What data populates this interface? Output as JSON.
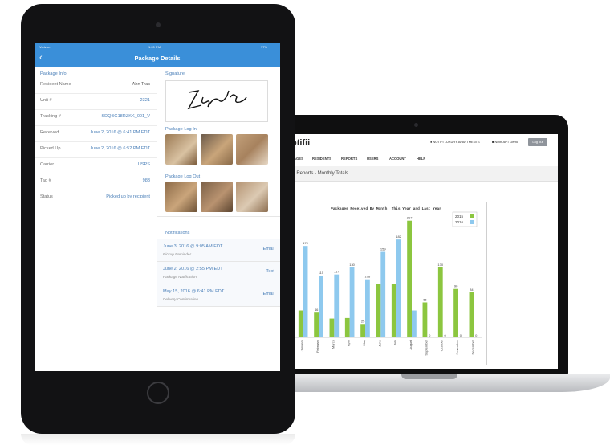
{
  "ipad": {
    "status": {
      "carrier": "Verizon",
      "time": "1:20 PM",
      "battery": "77%"
    },
    "title": "Package Details",
    "package_info_header": "Package Info",
    "info_rows": [
      {
        "key": "Resident Name",
        "value": "Ahn Tras"
      },
      {
        "key": "Unit #",
        "value": "2321"
      },
      {
        "key": "Tracking #",
        "value": "SDQBG18RZKK_001_V"
      },
      {
        "key": "Received",
        "value": "June 2, 2016 @ 6:41 PM EDT"
      },
      {
        "key": "Picked Up",
        "value": "June 2, 2016 @ 6:52 PM EDT"
      },
      {
        "key": "Carrier",
        "value": "USPS"
      },
      {
        "key": "Tag #",
        "value": "983"
      },
      {
        "key": "Status",
        "value": "Picked up by recipient"
      }
    ],
    "signature_label": "Signature",
    "log_in_label": "Package Log In",
    "log_out_label": "Package Log Out",
    "notifications_label": "Notifications",
    "notifications": [
      {
        "date": "June 3, 2016 @ 9:05 AM EDT",
        "type": "Pickup Reminder",
        "method": "Email"
      },
      {
        "date": "June 2, 2016 @ 2:55 PM EDT",
        "type": "Package Notification",
        "method": "Text"
      },
      {
        "date": "May 15, 2016 @ 6:41 PM EDT",
        "type": "Delivery Confirmation",
        "method": "Email"
      }
    ]
  },
  "laptop": {
    "brand": "otifii",
    "apartment": "NOTIFI LUXURY APARTMENTS",
    "user": "Notifi APT Demo",
    "logout": "Log out",
    "nav": [
      "KAGES",
      "RESIDENTS",
      "REPORTS",
      "USERS",
      "ACCOUNT",
      "HELP"
    ],
    "subtitle": "ge Reports - Monthly Totals"
  },
  "chart_data": {
    "type": "bar",
    "title": "Packages Received By Month, This Year and Last Year",
    "categories": [
      "January",
      "February",
      "March",
      "April",
      "May",
      "June",
      "July",
      "August",
      "September",
      "October",
      "November",
      "December"
    ],
    "series": [
      {
        "name": "2015",
        "color": "#8cc63f",
        "values": [
          50,
          46,
          35,
          36,
          25,
          100,
          100,
          217,
          65,
          130,
          90,
          84
        ]
      },
      {
        "name": "2016",
        "color": "#8ec9ee",
        "values": [
          170,
          115,
          117,
          130,
          108,
          159,
          182,
          50,
          0,
          0,
          0,
          0
        ]
      }
    ],
    "data_labels": [
      {
        "series": 0,
        "index": 1,
        "text": "46"
      },
      {
        "series": 0,
        "index": 4,
        "text": "25"
      },
      {
        "series": 0,
        "index": 7,
        "text": "217"
      },
      {
        "series": 0,
        "index": 9,
        "text": "130"
      },
      {
        "series": 0,
        "index": 10,
        "text": "90"
      },
      {
        "series": 0,
        "index": 11,
        "text": "84"
      },
      {
        "series": 1,
        "index": 0,
        "text": "170"
      },
      {
        "series": 1,
        "index": 1,
        "text": "115"
      },
      {
        "series": 1,
        "index": 2,
        "text": "117"
      },
      {
        "series": 1,
        "index": 3,
        "text": "130"
      },
      {
        "series": 1,
        "index": 4,
        "text": "108"
      },
      {
        "series": 1,
        "index": 5,
        "text": "159"
      },
      {
        "series": 1,
        "index": 6,
        "text": "182"
      },
      {
        "series": 0,
        "index": 8,
        "text": "65"
      }
    ],
    "zero_labels": [
      {
        "series": 1,
        "index": 8,
        "text": "0"
      },
      {
        "series": 1,
        "index": 9,
        "text": "0"
      },
      {
        "series": 1,
        "index": 10,
        "text": "0"
      },
      {
        "series": 1,
        "index": 11,
        "text": "0"
      }
    ],
    "ylim": [
      0,
      230
    ],
    "legend": "top-right"
  }
}
